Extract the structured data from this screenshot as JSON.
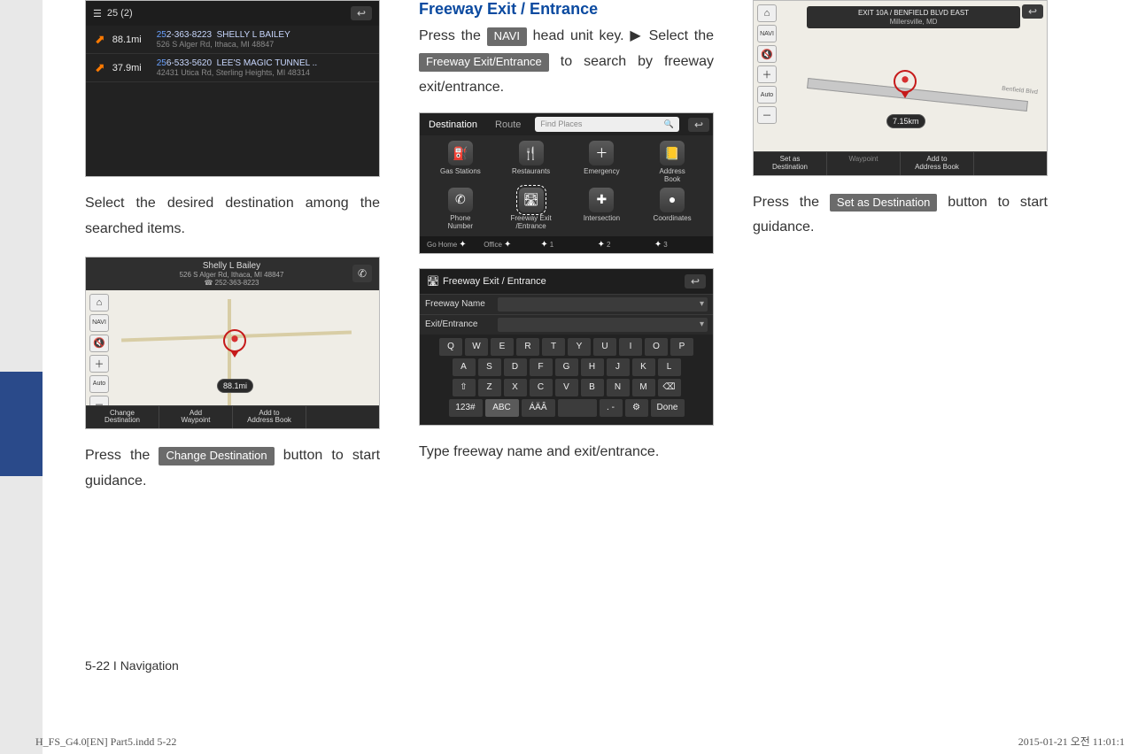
{
  "col1": {
    "shot_search": {
      "header": "25 (2)",
      "rows": [
        {
          "distance": "88.1mi",
          "hl": "25",
          "phone_rest": "2-363-8223",
          "name": "SHELLY L BAILEY",
          "addr": "526 S Alger Rd, Ithaca, MI 48847"
        },
        {
          "distance": "37.9mi",
          "hl": "25",
          "phone_rest": "6-533-5620",
          "name": "LEE'S MAGIC TUNNEL ..",
          "addr": "42431 Utica Rd, Sterling Heights, MI 48314"
        }
      ]
    },
    "caption1": "Select the desired destination among the searched items.",
    "shot_map": {
      "header_name": "Shelly L Bailey",
      "header_addr": "526 S Alger Rd, Ithaca, MI 48847",
      "header_phone": "☎ 252-363-8223",
      "distance": "88.1mi",
      "footer": [
        "Change\nDestination",
        "Add\nWaypoint",
        "Add to\nAddress Book",
        ""
      ]
    },
    "text2_pre": "Press the ",
    "key1": "Change Destination",
    "text2_post": " button to start guidance."
  },
  "col2": {
    "heading": "Freeway Exit / Entrance",
    "p1_a": "Press the ",
    "key_navi": "NAVI",
    "p1_b": " head unit key. ▶ Select the ",
    "key_fwy": "Freeway Exit/Entrance",
    "p1_c": " to search by free­way exit/entrance.",
    "shot_dest": {
      "tabs": [
        "Destination",
        "Route"
      ],
      "search_placeholder": "Find Places",
      "grid": [
        {
          "label": "Gas Stations",
          "glyph": "⛽"
        },
        {
          "label": "Restaurants",
          "glyph": "🍴"
        },
        {
          "label": "Emergency",
          "glyph": "＋"
        },
        {
          "label": "Address\nBook",
          "glyph": "📒"
        },
        {
          "label": "Phone\nNumber",
          "glyph": "✆"
        },
        {
          "label": "Freeway Exit\n/Entrance",
          "glyph": "🛣",
          "highlight": true
        },
        {
          "label": "Intersection",
          "glyph": "✚"
        },
        {
          "label": "Coordinates",
          "glyph": "●"
        }
      ],
      "bottom": [
        "Go Home",
        "Office",
        "1",
        "2",
        "3"
      ]
    },
    "shot_kbd": {
      "title": "Freeway Exit / Entrance",
      "field1": "Freeway Name",
      "field2": "Exit/Entrance",
      "row1": [
        "Q",
        "W",
        "E",
        "R",
        "T",
        "Y",
        "U",
        "I",
        "O",
        "P"
      ],
      "row2": [
        "A",
        "S",
        "D",
        "F",
        "G",
        "H",
        "J",
        "K",
        "L"
      ],
      "row3": [
        "⇧",
        "Z",
        "X",
        "C",
        "V",
        "B",
        "N",
        "M",
        "⌫"
      ],
      "row4": [
        "123#",
        "ABC",
        "ÁÄÂ",
        "␣",
        ". -",
        "⚙",
        "Done"
      ]
    },
    "caption2": "Type freeway name and exit/entrance."
  },
  "col3": {
    "shot_map2": {
      "title_line1": "EXIT 10A / BENFIELD BLVD EAST",
      "title_line2": "Millersville, MD",
      "distance": "7.15km",
      "footer": [
        "Set as\nDestination",
        "Waypoint",
        "Add to\nAddress Book",
        ""
      ]
    },
    "text_pre": "Press the ",
    "key_set": "Set as Destination",
    "text_post": " button to start guidance."
  },
  "page_footer": "5-22 I Navigation",
  "indd": "H_FS_G4.0[EN] Part5.indd   5-22",
  "date": "2015-01-21   오전 11:01:1"
}
